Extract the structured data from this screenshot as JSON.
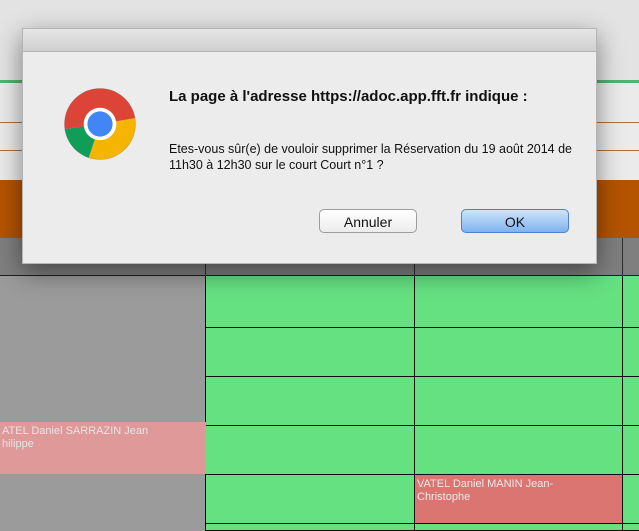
{
  "dialog": {
    "title": "La page à l'adresse https://adoc.app.fft.fr indique :",
    "message": "Etes-vous sûr(e) de vouloir supprimer la  Réservation du 19 août 2014 de 11h30 à 12h30 sur le court Court n°1 ?",
    "cancel_label": "Annuler",
    "ok_label": "OK",
    "icon": "chrome-logo-icon"
  },
  "grid": {
    "booking_left": "ATEL Daniel SARRAZIN Jean\nhilippe",
    "booking_right": "VATEL Daniel MANIN Jean-\nChristophe"
  },
  "colors": {
    "free_slot": "#6ef58c",
    "booked_pink": "#f4a6a6",
    "booked_red": "#ee7f7b",
    "header_orange": "#c45c00",
    "ok_button": "#7fb3ef"
  }
}
